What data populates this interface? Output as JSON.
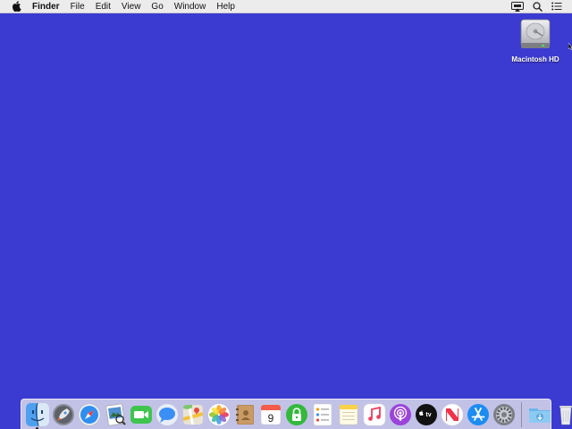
{
  "menubar": {
    "apple_icon": "apple-logo-icon",
    "app_name": "Finder",
    "items": [
      "File",
      "Edit",
      "View",
      "Go",
      "Window",
      "Help"
    ],
    "status_icons": [
      "airplay-display-icon",
      "spotlight-search-icon",
      "notification-center-icon"
    ]
  },
  "desktop": {
    "background_color": "#3b3ad1",
    "icons": [
      {
        "label": "Macintosh HD",
        "icon": "hard-drive-icon"
      }
    ]
  },
  "dock": {
    "apps": [
      "finder",
      "launchpad",
      "safari",
      "preview",
      "facetime",
      "messages",
      "maps",
      "photos",
      "contacts",
      "calendar",
      "keychain-access",
      "reminders",
      "notes",
      "music",
      "podcasts",
      "apple-tv",
      "news",
      "app-store",
      "system-preferences"
    ],
    "calendar_day": "9",
    "tv_label": "tv",
    "extras": [
      "downloads-folder",
      "trash"
    ]
  }
}
